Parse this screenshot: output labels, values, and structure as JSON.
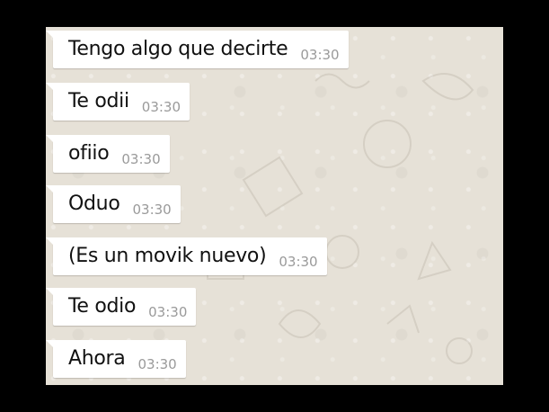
{
  "messages": [
    {
      "text": "Tengo algo que decirte",
      "time": "03:30"
    },
    {
      "text": "Te odii",
      "time": "03:30"
    },
    {
      "text": "ofiio",
      "time": "03:30"
    },
    {
      "text": "Oduo",
      "time": "03:30"
    },
    {
      "text": "(Es un movik nuevo)",
      "time": "03:30"
    },
    {
      "text": "Te odio",
      "time": "03:30"
    },
    {
      "text": "Ahora",
      "time": "03:30"
    }
  ]
}
